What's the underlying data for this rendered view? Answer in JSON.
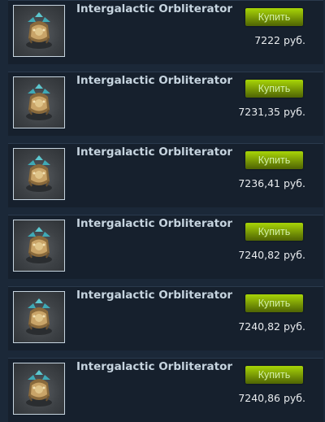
{
  "listings": [
    {
      "item_name": "Intergalactic Orbliterator",
      "buy_label": "Купить",
      "price": "7222 руб.",
      "thumbnail": "orbliterator-item-image"
    },
    {
      "item_name": "Intergalactic Orbliterator",
      "buy_label": "Купить",
      "price": "7231,35 руб.",
      "thumbnail": "orbliterator-item-image"
    },
    {
      "item_name": "Intergalactic Orbliterator",
      "buy_label": "Купить",
      "price": "7236,41 руб.",
      "thumbnail": "orbliterator-item-image"
    },
    {
      "item_name": "Intergalactic Orbliterator",
      "buy_label": "Купить",
      "price": "7240,82 руб.",
      "thumbnail": "orbliterator-item-image"
    },
    {
      "item_name": "Intergalactic Orbliterator",
      "buy_label": "Купить",
      "price": "7240,82 руб.",
      "thumbnail": "orbliterator-item-image"
    },
    {
      "item_name": "Intergalactic Orbliterator",
      "buy_label": "Купить",
      "price": "7240,86 руб.",
      "thumbnail": "orbliterator-item-image"
    }
  ],
  "colors": {
    "background": "#1b2838",
    "row_background": "#16202d",
    "name_text": "#c6d4df",
    "price_text": "#e9ecef",
    "button_green_top": "#a4d007",
    "button_green_bottom": "#536904",
    "button_text": "#d2efa9"
  }
}
